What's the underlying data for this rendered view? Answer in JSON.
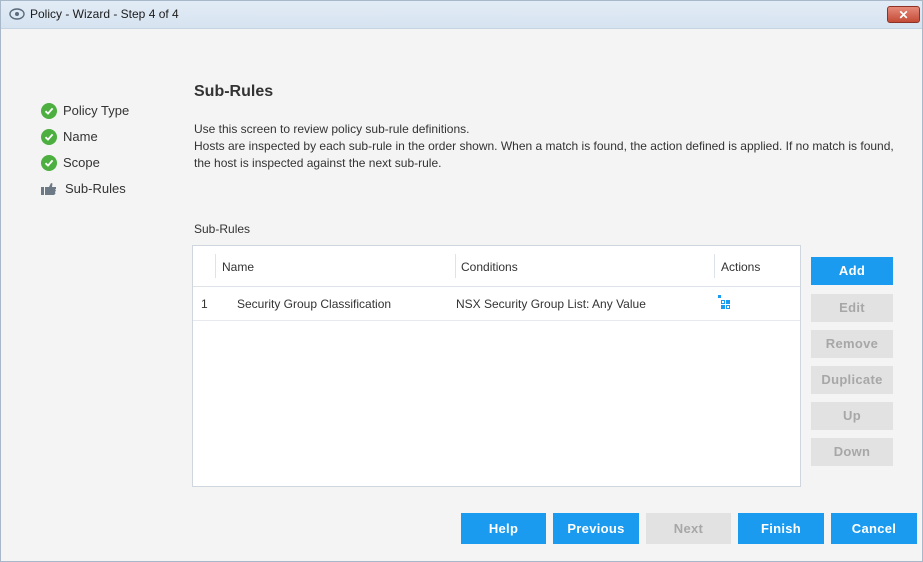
{
  "window": {
    "title": "Policy - Wizard - Step 4 of 4",
    "close_label": "✕"
  },
  "nav": {
    "items": [
      {
        "label": "Policy Type",
        "state": "done"
      },
      {
        "label": "Name",
        "state": "done"
      },
      {
        "label": "Scope",
        "state": "done"
      },
      {
        "label": "Sub-Rules",
        "state": "current"
      }
    ]
  },
  "main": {
    "title": "Sub-Rules",
    "desc_line1": "Use this screen to review policy sub-rule definitions.",
    "desc_line2": "Hosts are inspected by each sub-rule in the order shown. When a match is found, the action defined is applied. If no match is found, the host is inspected against the next sub-rule.",
    "table_label": "Sub-Rules",
    "columns": [
      "Name",
      "Conditions",
      "Actions"
    ],
    "rows": [
      {
        "index": "1",
        "name": "Security Group Classification",
        "conditions": "NSX Security Group List: Any Value",
        "action_icon": "classify-icon"
      }
    ]
  },
  "side_buttons": {
    "add": "Add",
    "edit": "Edit",
    "remove": "Remove",
    "duplicate": "Duplicate",
    "up": "Up",
    "down": "Down"
  },
  "footer": {
    "help": "Help",
    "previous": "Previous",
    "next": "Next",
    "finish": "Finish",
    "cancel": "Cancel"
  },
  "colors": {
    "accent": "#1a9bef",
    "check": "#4caf3f",
    "disabled_bg": "#e2e2e2",
    "close": "#c34b36"
  }
}
